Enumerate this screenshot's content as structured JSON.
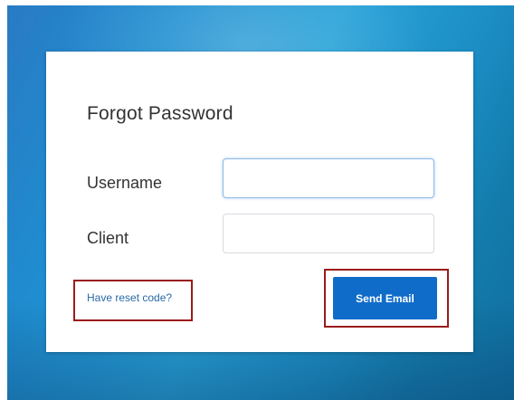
{
  "form": {
    "title": "Forgot Password",
    "username_label": "Username",
    "username_value": "",
    "client_label": "Client",
    "client_value": "",
    "reset_link": "Have reset code?",
    "send_button": "Send Email"
  },
  "colors": {
    "accent": "#0f6cc9",
    "link": "#2a6aa8",
    "highlight_border": "#9b1b1b",
    "background": "#1f8ed0"
  }
}
